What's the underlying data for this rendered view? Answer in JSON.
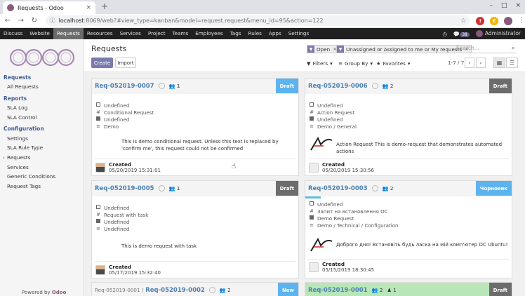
{
  "browser": {
    "tab_title": "Requests - Odoo",
    "tab_close": "×",
    "new_tab": "+",
    "url_host": "localhost",
    "url_rest": ":8069/web?#view_type=kanban&model=request.request&menu_id=95&action=122",
    "window_buttons": [
      "–",
      "□",
      "×"
    ]
  },
  "navbar": {
    "items": [
      "Discuss",
      "Website",
      "Requests",
      "Resources",
      "Services",
      "Project",
      "Teams",
      "Employees",
      "Tags",
      "Rules",
      "Apps",
      "Settings"
    ],
    "active": "Requests",
    "chat_count": "38",
    "user": "Administrator"
  },
  "sidebar": {
    "sections": [
      {
        "title": "Requests",
        "items": [
          "All Requests"
        ]
      },
      {
        "title": "Reports",
        "items": [
          "SLA Log",
          "SLA Control"
        ]
      },
      {
        "title": "Configuration",
        "items": [
          "Settings",
          "SLA Rule Type",
          "Requests",
          "Services",
          "Generic Conditions",
          "Request Tags"
        ]
      }
    ],
    "powered_by": "Powered by",
    "brand": "Odoo"
  },
  "control": {
    "title": "Requests",
    "create": "Create",
    "import": "Import",
    "facet1": "Open",
    "facet2": "Unassigned or Assigned to me or My requests",
    "search_placeholder": "Search...",
    "filters": "Filters",
    "group_by": "Group By",
    "favorites": "Favorites",
    "pager": "1-7 / 7"
  },
  "colors": {
    "create": "#7c7bad",
    "stage_draft": "#6c6c6c",
    "stage_blue": "#5bb3f0"
  },
  "cards": [
    {
      "title": "Req-052019-0007",
      "followers": "1",
      "stage": "Draft",
      "props": [
        "Undefined",
        "Conditional Request",
        "Undefined",
        "Demo"
      ],
      "desc": "This is demo conditional request. Unless this text is replaced by 'confirm me', this request could not be confirmed",
      "created": "Created",
      "date": "05/20/2019 15:31:01"
    },
    {
      "title": "Req-052019-0006",
      "followers": "2",
      "stage": "Draft",
      "props": [
        "Undefined",
        "Action Request",
        "Undefined",
        "Demo / General"
      ],
      "desc": "Action Request This is demo-request that demonstrates automated actions",
      "created": "Created",
      "date": "05/20/2019 15:30:56"
    },
    {
      "title": "Req-052019-0005",
      "followers": "1",
      "stage": "Draft",
      "props": [
        "Undefined",
        "Request with task",
        "Undefined",
        "Undefined"
      ],
      "desc": "This is demo request with task",
      "created": "Created",
      "date": "05/17/2019 15:32:40"
    },
    {
      "title": "Req-052019-0003",
      "followers": "2",
      "stage": "Чорновик",
      "props": [
        "Undefined",
        "Запит на встановлення ОС",
        "Demo Request",
        "Demo / Technical / Configuration"
      ],
      "desc": "Доброго дня! Встановіть будь ласка на мій комп'ютер ОС Ubuntu!",
      "created": "Created",
      "date": "05/15/2019 18:30:45"
    },
    {
      "parent": "Req-052019-0001 /",
      "title": "Req-052019-0002",
      "followers": "2",
      "stage": "New"
    },
    {
      "title": "Req-052019-0001",
      "followers": "2",
      "tasks": "1",
      "stage": "Draft"
    }
  ]
}
